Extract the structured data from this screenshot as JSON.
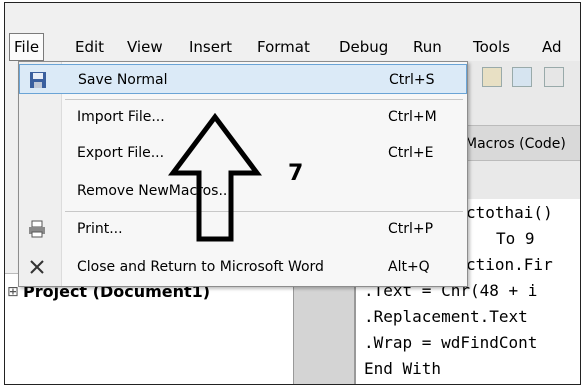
{
  "menubar": {
    "items": [
      {
        "label": "File",
        "active": true
      },
      {
        "label": "Edit"
      },
      {
        "label": "View"
      },
      {
        "label": "Insert"
      },
      {
        "label": "Format"
      },
      {
        "label": "Debug"
      },
      {
        "label": "Run"
      },
      {
        "label": "Tools"
      },
      {
        "label": "Ad"
      }
    ]
  },
  "file_menu": {
    "items": [
      {
        "label": "Save Normal",
        "shortcut": "Ctrl+S",
        "icon": "floppy-disk-icon",
        "highlighted": true
      },
      {
        "label": "Import File...",
        "shortcut": "Ctrl+M"
      },
      {
        "label": "Export File...",
        "shortcut": "Ctrl+E"
      },
      {
        "label": "Remove NewMacros...",
        "shortcut": ""
      },
      {
        "label": "Print...",
        "shortcut": "Ctrl+P",
        "icon": "printer-icon"
      },
      {
        "label": "Close and Return to Microsoft Word",
        "shortcut": "Alt+Q",
        "icon": "close-icon"
      }
    ]
  },
  "module_tab": {
    "title": "Macros (Code)"
  },
  "project": {
    "label": "Project (Document1)"
  },
  "code_lines": [
    "ctothai()",
    "To 9",
    "ction.Fir",
    ".Text = Chr(48 + i",
    ".Replacement.Text",
    ".Wrap = wdFindCont",
    "End With"
  ],
  "annotation": {
    "text": "7"
  },
  "colors": {
    "highlight": "#dbeaf7",
    "highlight_border": "#6aa4d6",
    "menu_bg": "#f7f7f7"
  }
}
